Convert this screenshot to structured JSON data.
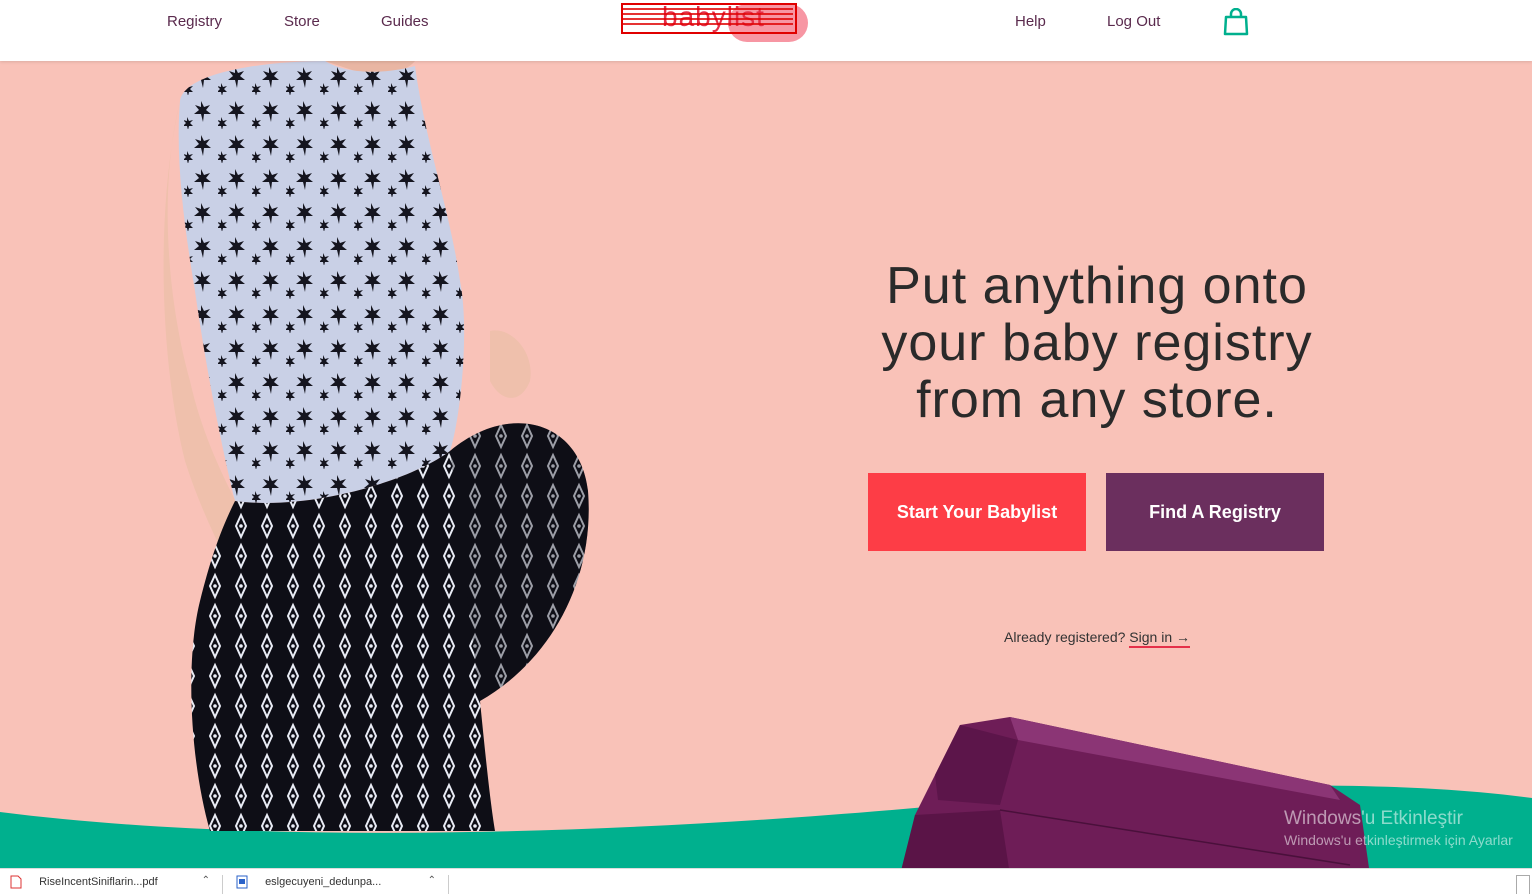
{
  "nav": {
    "registry": "Registry",
    "store": "Store",
    "guides": "Guides",
    "help": "Help",
    "logout": "Log Out",
    "logo_text": "babylist",
    "bag_icon": "shopping-bag-icon"
  },
  "hero": {
    "title": "Put anything onto your baby registry from any store.",
    "start_button": "Start Your Babylist",
    "find_button": "Find A Registry",
    "already_text": "Already registered?",
    "signin_text": "Sign in →"
  },
  "watermark": {
    "line1": "Windows'u Etkinleştir",
    "line2": "Windows'u etkinleştirmek için Ayarlar"
  },
  "downloads": {
    "item1": "RiseIncentSiniflarin...pdf",
    "item2": "eslgecuyeni_dedunpa..."
  },
  "colors": {
    "background": "#f9c2b8",
    "primary_red": "#fd3d46",
    "plum": "#6b2f5e",
    "teal": "#00b08e"
  }
}
